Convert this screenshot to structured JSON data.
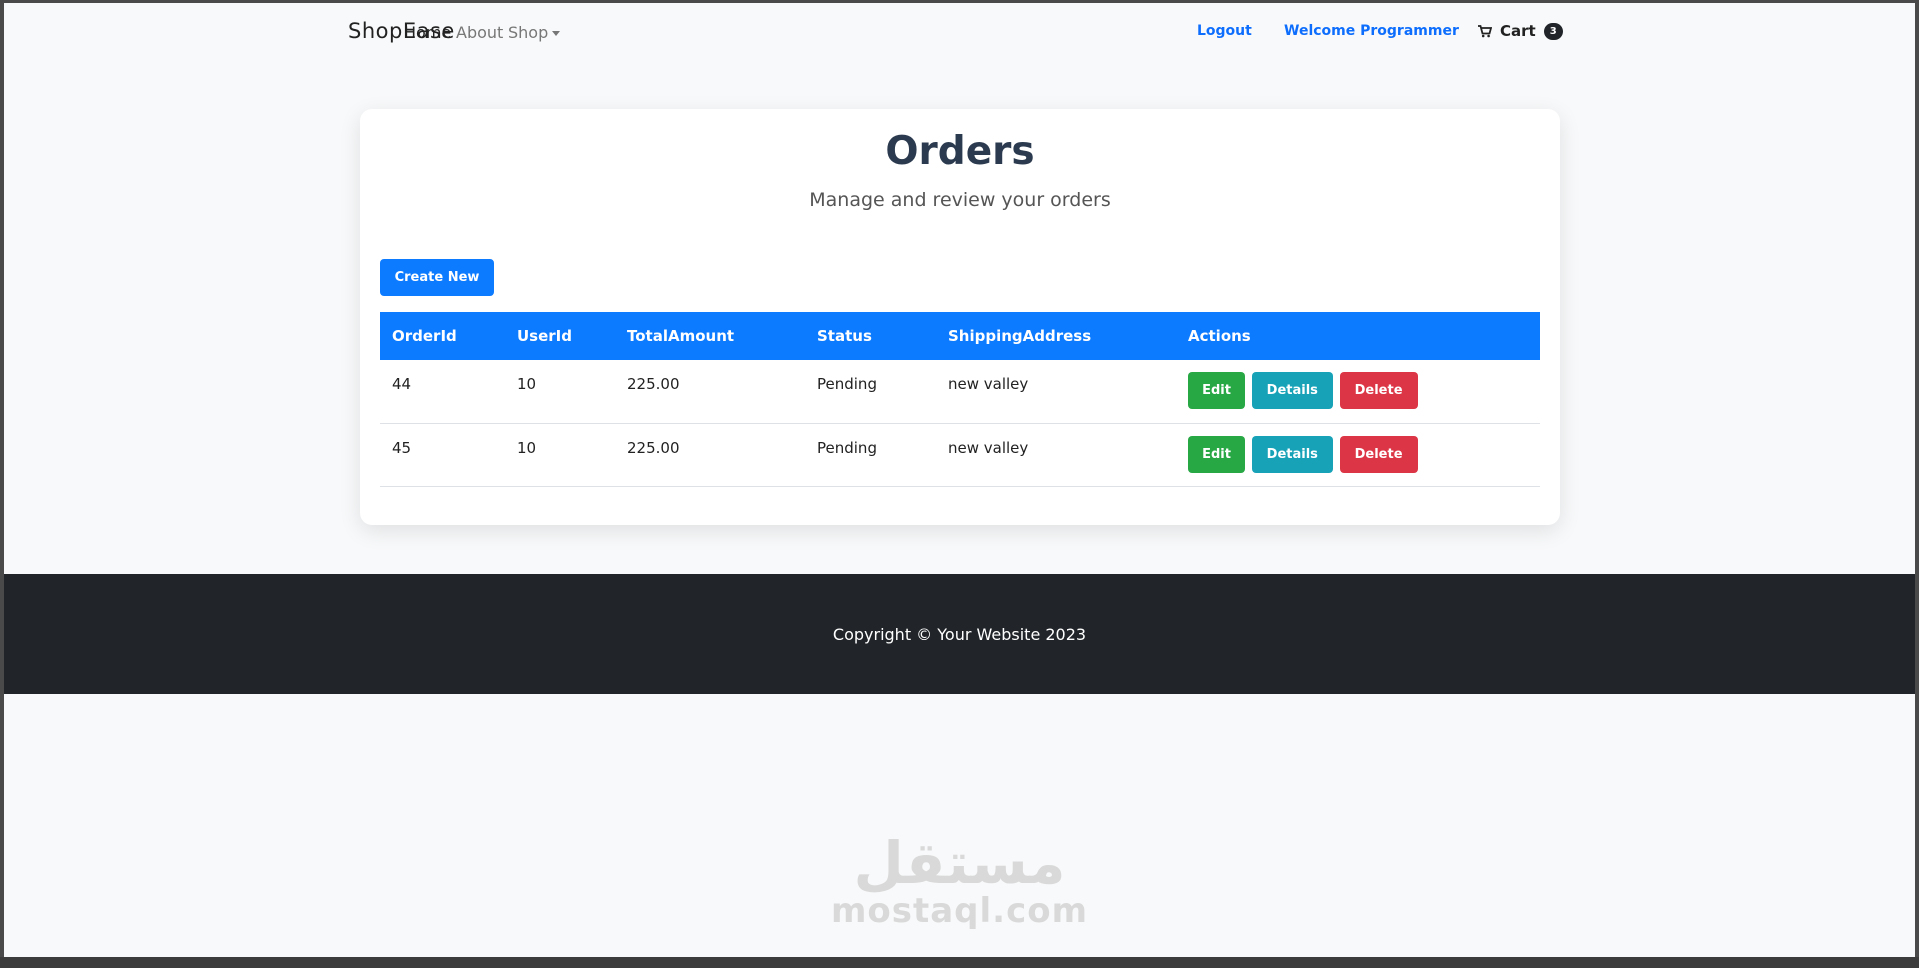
{
  "navbar": {
    "brand": "ShopEase",
    "links": [
      {
        "label": "Home"
      },
      {
        "label": "About"
      },
      {
        "label": "Shop"
      }
    ],
    "logout_label": "Logout",
    "welcome_label": "Welcome Programmer",
    "cart_label": "Cart",
    "cart_count": "3"
  },
  "page": {
    "title": "Orders",
    "subtitle": "Manage and review your orders",
    "create_label": "Create New"
  },
  "table": {
    "columns": [
      "OrderId",
      "UserId",
      "TotalAmount",
      "Status",
      "ShippingAddress",
      "Actions"
    ],
    "rows": [
      {
        "order_id": "44",
        "user_id": "10",
        "total": "225.00",
        "status": "Pending",
        "address": "new valley"
      },
      {
        "order_id": "45",
        "user_id": "10",
        "total": "225.00",
        "status": "Pending",
        "address": "new valley"
      }
    ],
    "action_labels": {
      "edit": "Edit",
      "details": "Details",
      "delete": "Delete"
    }
  },
  "footer": {
    "copyright": "Copyright © Your Website 2023"
  },
  "watermark": {
    "arabic": "مستقل",
    "latin": "mostaql.com"
  },
  "colors": {
    "primary": "#0d7bff",
    "success": "#28a745",
    "info": "#17a2b8",
    "danger": "#dc3545",
    "footer": "#212529"
  },
  "icons": {
    "cart": "cart-icon",
    "dropdown": "caret-down-icon"
  }
}
